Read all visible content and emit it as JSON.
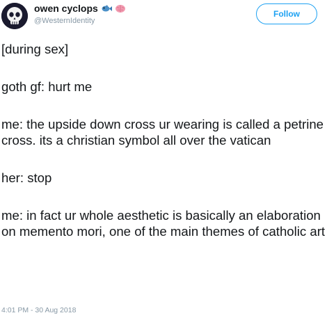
{
  "tweet": {
    "display_name": "owen cyclops",
    "handle": "@WesternIdentity",
    "follow_label": "Follow",
    "paragraphs": [
      "[during sex]",
      "goth gf: hurt me",
      "me: the upside down cross ur wearing is called a petrine cross. its a christian symbol all over the vatican",
      "her: stop",
      "me: in fact ur whole aesthetic is basically an elaboration on memento mori, one of the main themes of catholic art"
    ],
    "timestamp": "4:01 PM - 30 Aug 2018"
  },
  "colors": {
    "accent": "#1da1f2",
    "text": "#14171a",
    "muted": "#8899a6"
  },
  "icons": {
    "emoji_1": "fish-emoji",
    "emoji_2": "brain-emoji",
    "avatar": "skull-avatar"
  }
}
